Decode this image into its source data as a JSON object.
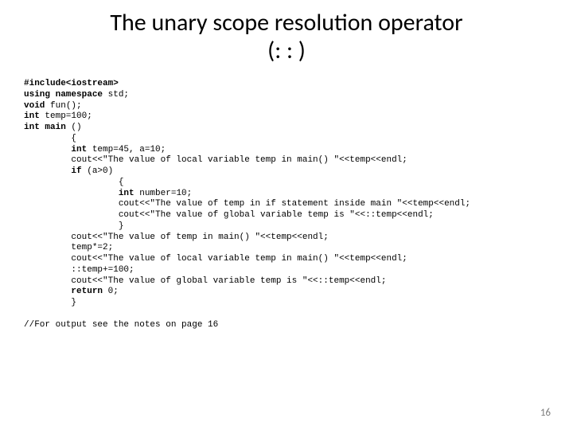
{
  "title_line1": "The unary scope resolution operator",
  "title_line2": "(: : )",
  "code": {
    "l01a": "#include<iostream> ",
    "l02a": "using namespace ",
    "l02b": "std;",
    "l03a": "void ",
    "l03b": "fun();",
    "l04a": "int ",
    "l04b": "temp=100;",
    "l05a": "int main ",
    "l05b": "()",
    "l06": "         {",
    "l07a": "         int ",
    "l07b": "temp=45, a=10;",
    "l08": "         cout<<\"The value of local variable temp in main() \"<<temp<<endl;",
    "l09a": "         if ",
    "l09b": "(a>0)",
    "l10": "                  {",
    "l11a": "                  int ",
    "l11b": "number=10;",
    "l12": "                  cout<<\"The value of temp in if statement inside main \"<<temp<<endl;",
    "l13": "                  cout<<\"The value of global variable temp is \"<<::temp<<endl;",
    "l14": "                  }",
    "l15": "         cout<<\"The value of temp in main() \"<<temp<<endl;",
    "l16": "         temp*=2;",
    "l17": "         cout<<\"The value of local variable temp in main() \"<<temp<<endl;",
    "l18": "         ::temp+=100;",
    "l19": "         cout<<\"The value of global variable temp is \"<<::temp<<endl;",
    "l20a": "         return ",
    "l20b": "0;",
    "l21": "         }",
    "l22": "",
    "l23": "//For output see the notes on page 16"
  },
  "pagenum": "16"
}
